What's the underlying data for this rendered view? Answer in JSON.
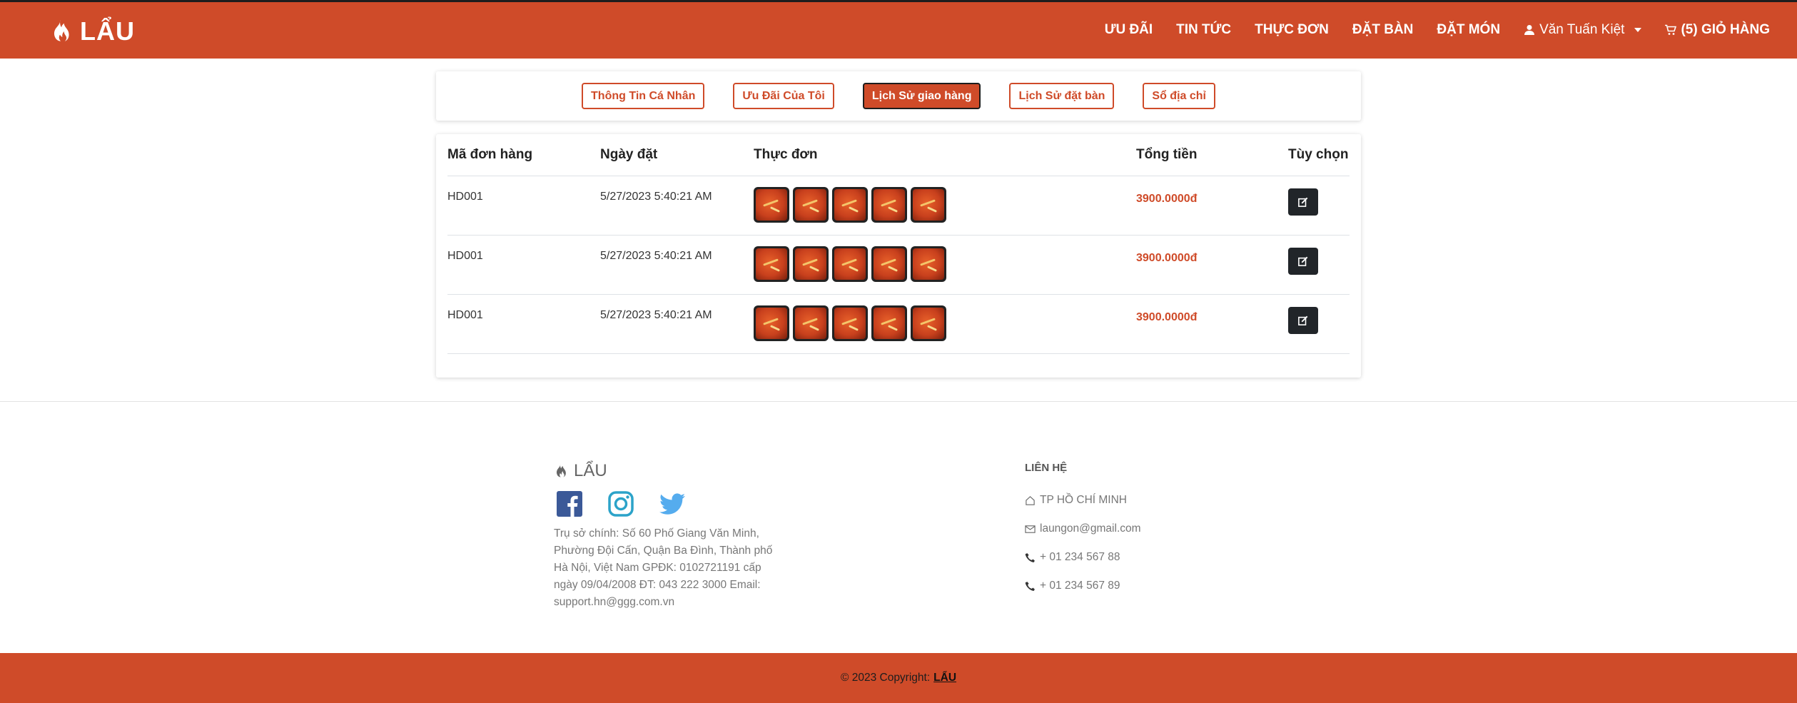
{
  "navbar": {
    "brand": "LẨU",
    "links": [
      "ƯU ĐÃI",
      "TIN TỨC",
      "THỰC ĐƠN",
      "ĐẶT BÀN",
      "ĐẶT MÓN"
    ],
    "user_name": "Văn Tuấn Kiệt",
    "cart_label": "(5) GIỎ HÀNG"
  },
  "tabs": [
    {
      "label": "Thông Tin Cá Nhân",
      "active": false
    },
    {
      "label": "Ưu Đãi Của Tôi",
      "active": false
    },
    {
      "label": "Lịch Sử giao hàng",
      "active": true
    },
    {
      "label": "Lịch Sử đặt bàn",
      "active": false
    },
    {
      "label": "Sổ địa chỉ",
      "active": false
    }
  ],
  "table": {
    "headers": {
      "order_id": "Mã đơn hàng",
      "date": "Ngày đặt",
      "menu": "Thực đơn",
      "total": "Tổng tiền",
      "options": "Tùy chọn"
    },
    "rows": [
      {
        "order_id": "HD001",
        "date": "5/27/2023 5:40:21 AM",
        "dish_count": 5,
        "total": "3900.0000đ"
      },
      {
        "order_id": "HD001",
        "date": "5/27/2023 5:40:21 AM",
        "dish_count": 5,
        "total": "3900.0000đ"
      },
      {
        "order_id": "HD001",
        "date": "5/27/2023 5:40:21 AM",
        "dish_count": 5,
        "total": "3900.0000đ"
      }
    ]
  },
  "footer": {
    "brand": "LẨU",
    "address": "Trụ sở chính: Số 60 Phố Giang Văn Minh, Phường Đội Cấn, Quận Ba Đình, Thành phố Hà Nội, Việt Nam GPĐK: 0102721191 cấp ngày 09/04/2008 ĐT: 043 222 3000 Email: support.hn@ggg.com.vn",
    "contact_title": "LIÊN HỆ",
    "city": "TP HỒ CHÍ MINH",
    "email": "laungon@gmail.com",
    "phone1": "+ 01 234 567 88",
    "phone2": "+ 01 234 567 89",
    "copyright": "© 2023 Copyright:",
    "copyright_brand": "LẨU"
  },
  "colors": {
    "primary": "#cf4b29",
    "dark": "#212529",
    "facebook": "#3b5998",
    "instagram": "#2ca3c9",
    "twitter": "#55acee"
  }
}
